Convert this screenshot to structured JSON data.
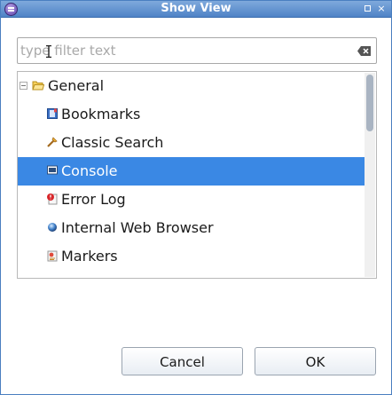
{
  "window": {
    "title": "Show View",
    "close_glyph": "×"
  },
  "filter": {
    "placeholder": "type filter text",
    "value": ""
  },
  "tree": {
    "group_label": "General",
    "items": [
      {
        "label": "Bookmarks",
        "icon": "bookmarks-icon"
      },
      {
        "label": "Classic Search",
        "icon": "classic-search-icon"
      },
      {
        "label": "Console",
        "icon": "console-icon",
        "selected": true
      },
      {
        "label": "Error Log",
        "icon": "error-log-icon"
      },
      {
        "label": "Internal Web Browser",
        "icon": "web-browser-icon"
      },
      {
        "label": "Markers",
        "icon": "markers-icon"
      }
    ]
  },
  "buttons": {
    "cancel": "Cancel",
    "ok": "OK"
  },
  "colors": {
    "selection": "#3a88e4",
    "titlebar": "#5a8ccc"
  }
}
